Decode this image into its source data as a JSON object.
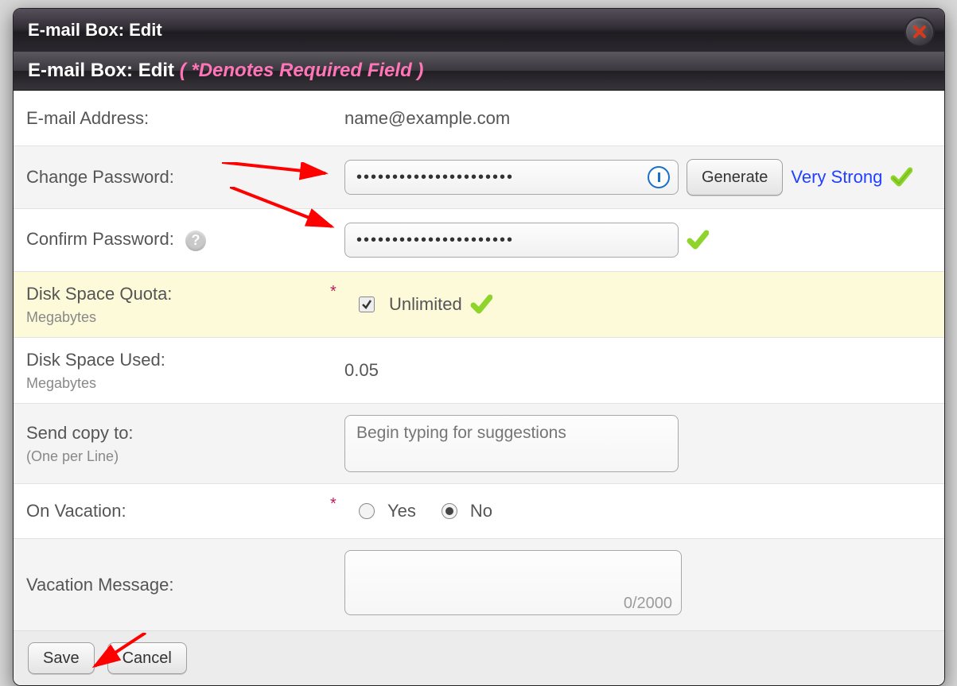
{
  "modal": {
    "title": "E-mail Box: Edit",
    "subtitle_prefix": "E-mail Box: Edit ",
    "required_note": "( *Denotes Required Field )"
  },
  "fields": {
    "email": {
      "label": "E-mail Address:",
      "value": "name@example.com"
    },
    "change_password": {
      "label": "Change Password:",
      "value": "••••••••••••••••••••••",
      "generate": "Generate",
      "strength": "Very Strong"
    },
    "confirm_password": {
      "label": "Confirm Password:",
      "value": "••••••••••••••••••••••"
    },
    "quota": {
      "label": "Disk Space Quota:",
      "sublabel": "Megabytes",
      "unlimited_label": "Unlimited",
      "unlimited_checked": true
    },
    "used": {
      "label": "Disk Space Used:",
      "sublabel": "Megabytes",
      "value": "0.05"
    },
    "send_copy": {
      "label": "Send copy to:",
      "sublabel": "(One per Line)",
      "placeholder": "Begin typing for suggestions"
    },
    "vacation": {
      "label": "On Vacation:",
      "yes": "Yes",
      "no": "No",
      "selected": "no"
    },
    "vacation_msg": {
      "label": "Vacation Message:",
      "char_count": "0/2000"
    }
  },
  "footer": {
    "save": "Save",
    "cancel": "Cancel"
  }
}
